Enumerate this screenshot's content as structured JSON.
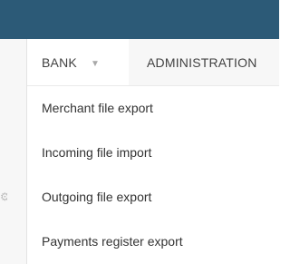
{
  "colors": {
    "topbar": "#2c5a77",
    "navbar_bg": "#f7f7f7",
    "active_tab_bg": "#ffffff",
    "text": "#333333",
    "caret": "#a8a8a8"
  },
  "navbar": {
    "bank_label": "BANK",
    "bank_caret": "▼",
    "administration_label": "ADMINISTRATION"
  },
  "bank_menu": {
    "items": [
      {
        "label": "Merchant file export"
      },
      {
        "label": "Incoming file import"
      },
      {
        "label": "Outgoing file export"
      },
      {
        "label": "Payments register export"
      }
    ]
  },
  "left_strip": {
    "icon": "gear-icon"
  }
}
